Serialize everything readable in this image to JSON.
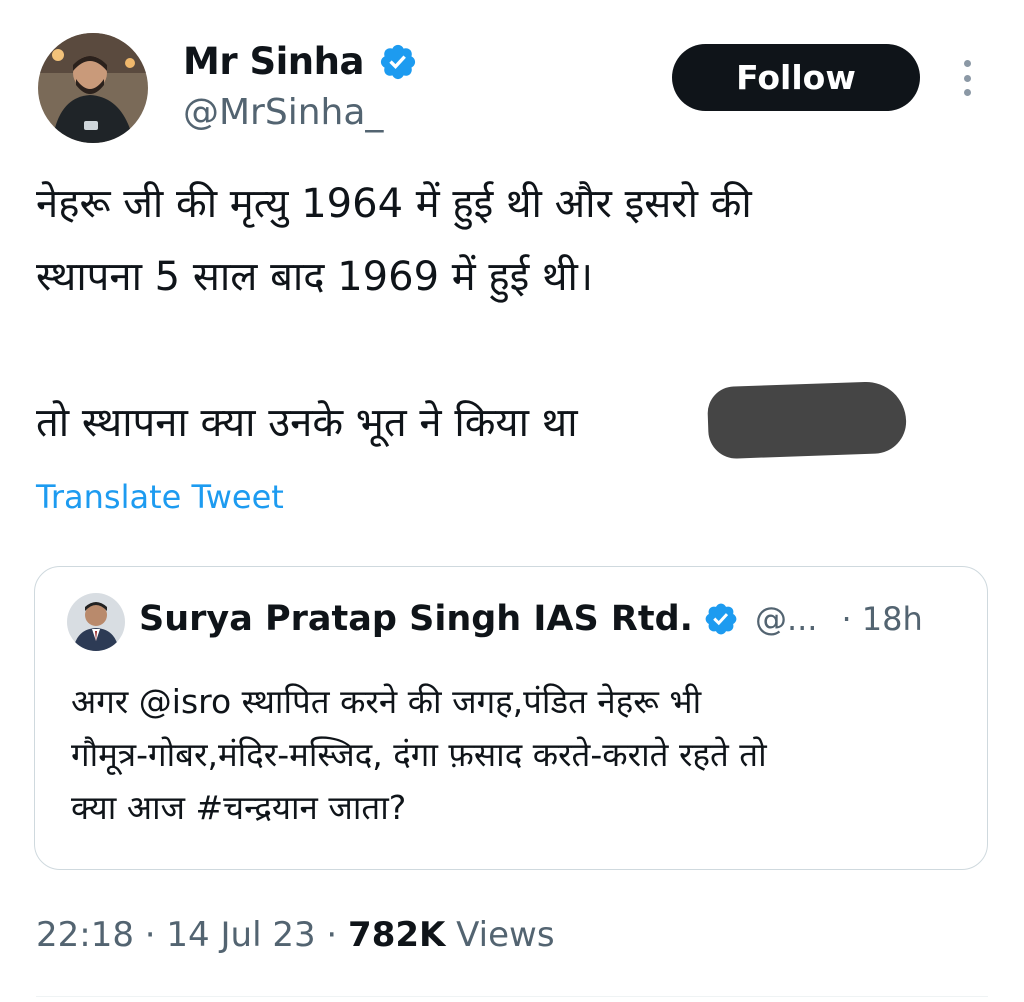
{
  "author": {
    "display_name": "Mr Sinha",
    "handle": "@MrSinha_",
    "verified_icon": "verified-badge-icon"
  },
  "actions": {
    "follow_label": "Follow",
    "more_icon": "more-vertical-icon"
  },
  "tweet": {
    "lines": [
      "नेहरू जी की मृत्यु 1964 में हुई थी और इसरो की",
      "स्थापना 5 साल बाद 1969 में हुई थी।",
      "",
      "तो स्थापना क्या उनके भूत ने किया था"
    ],
    "translate_label": "Translate Tweet"
  },
  "quoted_tweet": {
    "display_name": "Surya Pratap Singh IAS Rtd.",
    "handle": "@...",
    "time": "· 18h",
    "lines": [
      "अगर @isro स्थापित करने की जगह,पंडित नेहरू भी",
      "गौमूत्र-गोबर,मंदिर-मस्जिद, दंगा फ़साद करते-कराते रहते तो",
      "क्या आज #चन्द्रयान जाता?"
    ]
  },
  "meta": {
    "time": "22:18",
    "sep1": " · ",
    "date": "14 Jul 23",
    "sep2": " · ",
    "views_count": "782K",
    "views_label": " Views"
  },
  "colors": {
    "accent": "#1d9bf0",
    "text": "#0f1419",
    "secondary": "#536471",
    "follow_bg": "#0f1419",
    "border": "#cfd9de"
  }
}
